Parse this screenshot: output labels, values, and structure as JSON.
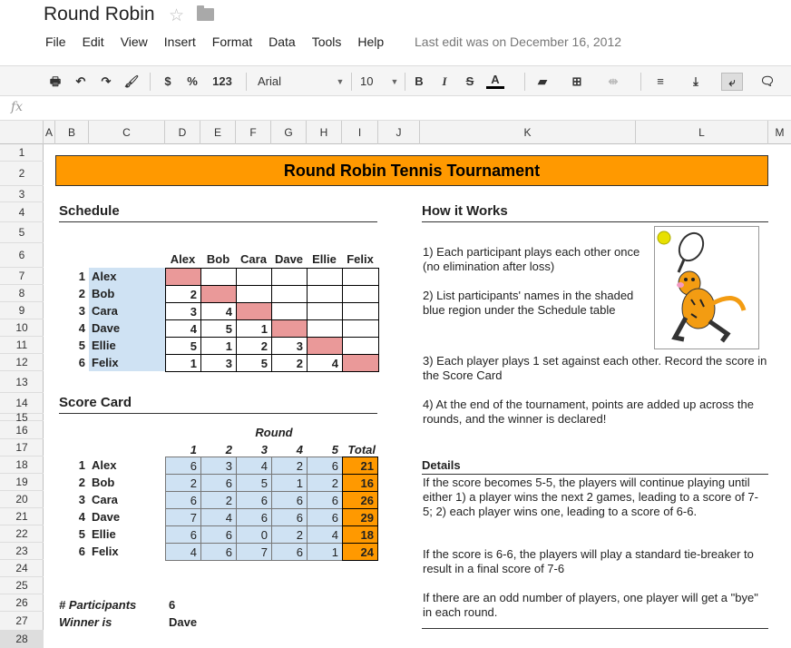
{
  "doc_title": "Round Robin",
  "menu": [
    "File",
    "Edit",
    "View",
    "Insert",
    "Format",
    "Data",
    "Tools",
    "Help"
  ],
  "last_edit": "Last edit was on December 16, 2012",
  "toolbar": {
    "currency": "$",
    "percent": "%",
    "numfmt": "123",
    "font": "Arial",
    "size": "10",
    "bold": "B",
    "italic": "I",
    "strike": "S",
    "textcolor": "A"
  },
  "fx": "fx",
  "columns": [
    "A",
    "B",
    "C",
    "D",
    "E",
    "F",
    "G",
    "H",
    "I",
    "J",
    "K",
    "L",
    "M"
  ],
  "rows": [
    "1",
    "2",
    "3",
    "4",
    "5",
    "6",
    "7",
    "8",
    "9",
    "10",
    "11",
    "12",
    "13",
    "14",
    "15",
    "16",
    "17",
    "18",
    "19",
    "20",
    "21",
    "22",
    "23",
    "24",
    "25",
    "26",
    "27",
    "28"
  ],
  "banner": "Round Robin Tennis Tournament",
  "schedule": {
    "heading": "Schedule",
    "players": [
      "Alex",
      "Bob",
      "Cara",
      "Dave",
      "Ellie",
      "Felix"
    ],
    "numbers": [
      "1",
      "2",
      "3",
      "4",
      "5",
      "6"
    ],
    "matrix": [
      [
        "",
        "",
        "",
        "",
        "",
        ""
      ],
      [
        "2",
        "",
        "",
        "",
        "",
        ""
      ],
      [
        "3",
        "4",
        "",
        "",
        "",
        ""
      ],
      [
        "4",
        "5",
        "1",
        "",
        "",
        ""
      ],
      [
        "5",
        "1",
        "2",
        "3",
        "",
        ""
      ],
      [
        "1",
        "3",
        "5",
        "2",
        "4",
        ""
      ]
    ]
  },
  "scorecard": {
    "heading": "Score Card",
    "round_label": "Round",
    "round_numbers": [
      "1",
      "2",
      "3",
      "4",
      "5"
    ],
    "total_label": "Total",
    "scores": [
      [
        "6",
        "3",
        "4",
        "2",
        "6"
      ],
      [
        "2",
        "6",
        "5",
        "1",
        "2"
      ],
      [
        "6",
        "2",
        "6",
        "6",
        "6"
      ],
      [
        "7",
        "4",
        "6",
        "6",
        "6"
      ],
      [
        "6",
        "6",
        "0",
        "2",
        "4"
      ],
      [
        "4",
        "6",
        "7",
        "6",
        "1"
      ]
    ],
    "totals": [
      "21",
      "16",
      "26",
      "29",
      "18",
      "24"
    ]
  },
  "summary": {
    "participants_label": "# Participants",
    "participants": "6",
    "winner_label": "Winner is",
    "winner": "Dave"
  },
  "how_it_works": {
    "heading": "How it Works",
    "p1": "1) Each participant plays each other once (no elimination after loss)",
    "p2": "2) List participants' names in the shaded blue region under the Schedule table",
    "p3": "3) Each player plays 1 set against each other. Record the score in the Score Card",
    "p4": "4) At the end of the tournament, points are added up across the rounds, and the winner is declared!"
  },
  "details": {
    "heading": "Details",
    "d1": "If the score becomes 5-5, the players will continue playing until either 1) a player wins the next 2 games, leading to a score of 7-5; 2) each player wins one, leading to a score of 6-6.",
    "d2": "If the score is 6-6, the players will play a standard tie-breaker to result in a final score of 7-6",
    "d3": "If there are an odd number of players, one player will get a \"bye\" in each round."
  },
  "colors": {
    "banner": "#ff9900",
    "names": "#cfe2f3",
    "diagonal": "#ea9999",
    "total": "#ff9900"
  }
}
